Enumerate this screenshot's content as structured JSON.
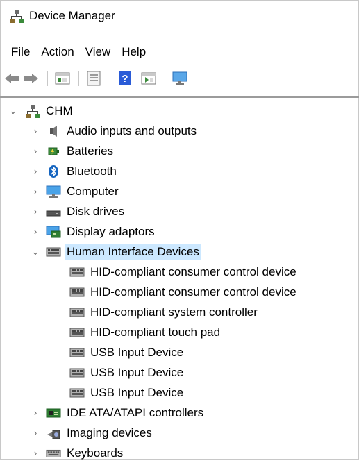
{
  "window": {
    "title": "Device Manager"
  },
  "menu": [
    "File",
    "Action",
    "View",
    "Help"
  ],
  "toolbar": [
    "back-icon",
    "forward-icon",
    "properties-icon",
    "update-icon",
    "help-icon",
    "run-icon",
    "monitor-icon"
  ],
  "tree": {
    "root": {
      "label": "CHM",
      "expanded": true
    },
    "categories": [
      {
        "label": "Audio inputs and outputs",
        "icon": "speaker-icon",
        "expanded": false
      },
      {
        "label": "Batteries",
        "icon": "battery-icon",
        "expanded": false
      },
      {
        "label": "Bluetooth",
        "icon": "bluetooth-icon",
        "expanded": false
      },
      {
        "label": "Computer",
        "icon": "computer-icon",
        "expanded": false
      },
      {
        "label": "Disk drives",
        "icon": "disk-icon",
        "expanded": false
      },
      {
        "label": "Display adaptors",
        "icon": "display-adapter-icon",
        "expanded": false
      },
      {
        "label": "Human Interface Devices",
        "icon": "hid-icon",
        "expanded": true,
        "selected": true,
        "children": [
          "HID-compliant consumer control device",
          "HID-compliant consumer control device",
          "HID-compliant system controller",
          "HID-compliant touch pad",
          "USB Input Device",
          "USB Input Device",
          "USB Input Device"
        ]
      },
      {
        "label": "IDE ATA/ATAPI controllers",
        "icon": "ide-icon",
        "expanded": false
      },
      {
        "label": "Imaging devices",
        "icon": "camera-icon",
        "expanded": false
      },
      {
        "label": "Keyboards",
        "icon": "keyboard-icon",
        "expanded": false
      }
    ]
  }
}
